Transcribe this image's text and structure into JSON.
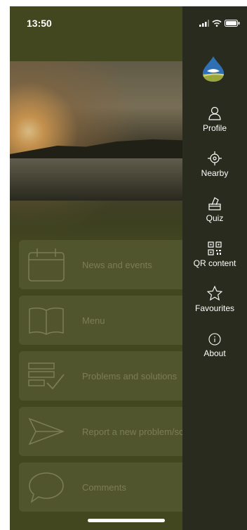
{
  "status": {
    "time": "13:50"
  },
  "grid": [
    {
      "label": "News and events",
      "icon": "calendar-icon"
    },
    {
      "label": "Menu",
      "icon": "book-icon"
    },
    {
      "label": "Problems and solutions",
      "icon": "checklist-icon"
    },
    {
      "label": "Report a new problem/sc",
      "icon": "send-icon"
    },
    {
      "label": "Comments",
      "icon": "speech-bubble-icon"
    }
  ],
  "drawer": {
    "items": [
      {
        "label": "Profile",
        "icon": "person-icon"
      },
      {
        "label": "Nearby",
        "icon": "crosshair-icon"
      },
      {
        "label": "Quiz",
        "icon": "ballot-box-icon"
      },
      {
        "label": "QR content",
        "icon": "qr-code-icon"
      },
      {
        "label": "Favourites",
        "icon": "star-icon"
      },
      {
        "label": "About",
        "icon": "info-icon"
      }
    ]
  },
  "colors": {
    "background": "#4a4e22",
    "drawer": "#282b1d",
    "card": "#5b5f32",
    "card_text": "#8e8f62"
  }
}
